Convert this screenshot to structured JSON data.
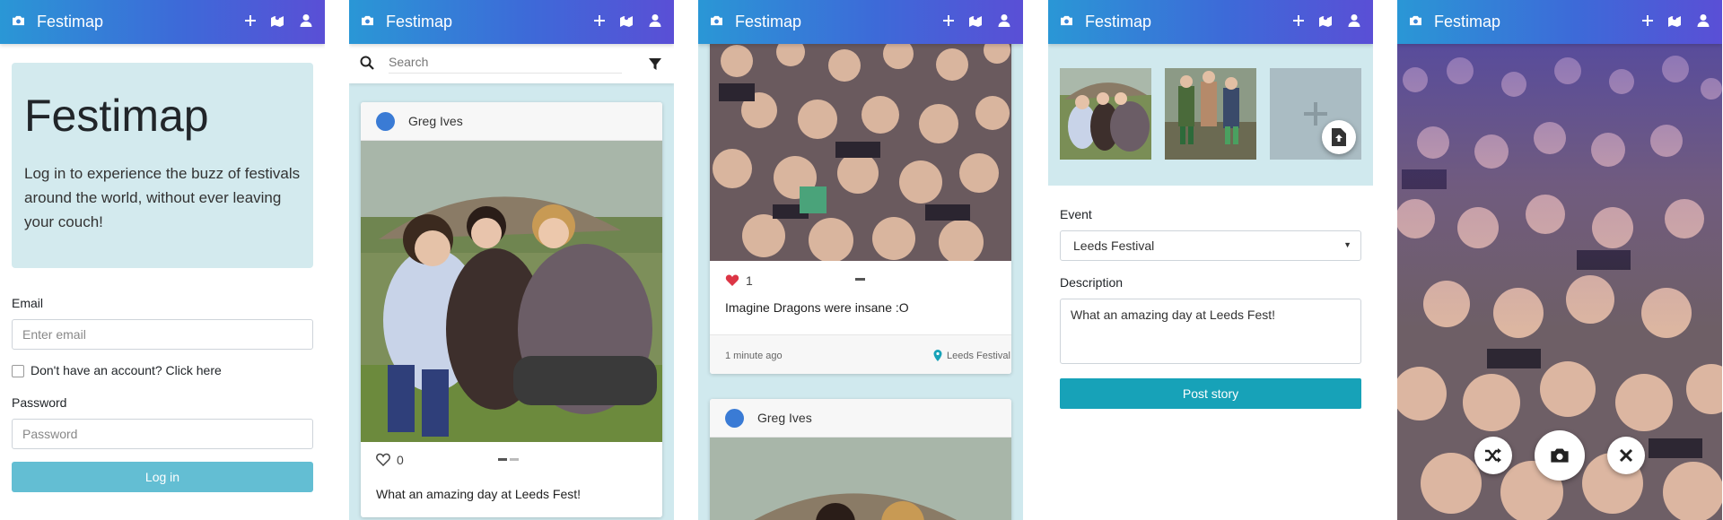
{
  "app": {
    "title": "Festimap"
  },
  "login": {
    "heading": "Festimap",
    "lead": "Log in to experience the buzz of festivals around the world, without ever leaving your couch!",
    "email_label": "Email",
    "email_placeholder": "Enter email",
    "signup_label": "Don't have an account? Click here",
    "password_label": "Password",
    "password_placeholder": "Password",
    "login_button": "Log in"
  },
  "feed": {
    "search_placeholder": "Search",
    "post": {
      "user": "Greg Ives",
      "likes": "0",
      "caption": "What an amazing day at Leeds Fest!"
    }
  },
  "detail": {
    "likes": "1",
    "caption": "Imagine Dragons were insane :O",
    "time": "1 minute ago",
    "location": "Leeds Festival",
    "next_user": "Greg Ives"
  },
  "upload": {
    "event_label": "Event",
    "event_value": "Leeds Festival",
    "description_label": "Description",
    "description_value": "What an amazing day at Leeds Fest!",
    "post_button": "Post story"
  },
  "colors": {
    "accent": "#17a2b8",
    "panel": "#d0e9ee",
    "heart": "#dc3545"
  }
}
